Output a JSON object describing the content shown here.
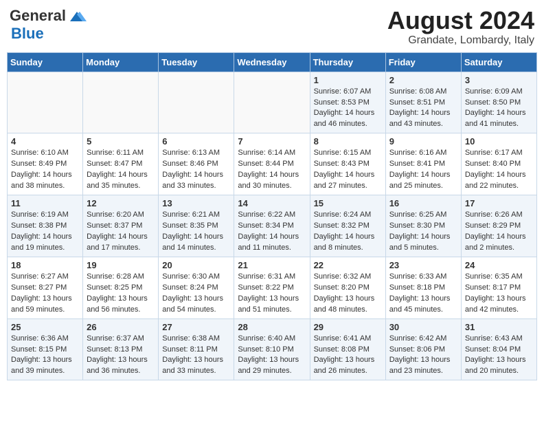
{
  "header": {
    "logo_general": "General",
    "logo_blue": "Blue",
    "month": "August 2024",
    "location": "Grandate, Lombardy, Italy"
  },
  "days_of_week": [
    "Sunday",
    "Monday",
    "Tuesday",
    "Wednesday",
    "Thursday",
    "Friday",
    "Saturday"
  ],
  "weeks": [
    [
      {
        "day": "",
        "info": ""
      },
      {
        "day": "",
        "info": ""
      },
      {
        "day": "",
        "info": ""
      },
      {
        "day": "",
        "info": ""
      },
      {
        "day": "1",
        "info": "Sunrise: 6:07 AM\nSunset: 8:53 PM\nDaylight: 14 hours and 46 minutes."
      },
      {
        "day": "2",
        "info": "Sunrise: 6:08 AM\nSunset: 8:51 PM\nDaylight: 14 hours and 43 minutes."
      },
      {
        "day": "3",
        "info": "Sunrise: 6:09 AM\nSunset: 8:50 PM\nDaylight: 14 hours and 41 minutes."
      }
    ],
    [
      {
        "day": "4",
        "info": "Sunrise: 6:10 AM\nSunset: 8:49 PM\nDaylight: 14 hours and 38 minutes."
      },
      {
        "day": "5",
        "info": "Sunrise: 6:11 AM\nSunset: 8:47 PM\nDaylight: 14 hours and 35 minutes."
      },
      {
        "day": "6",
        "info": "Sunrise: 6:13 AM\nSunset: 8:46 PM\nDaylight: 14 hours and 33 minutes."
      },
      {
        "day": "7",
        "info": "Sunrise: 6:14 AM\nSunset: 8:44 PM\nDaylight: 14 hours and 30 minutes."
      },
      {
        "day": "8",
        "info": "Sunrise: 6:15 AM\nSunset: 8:43 PM\nDaylight: 14 hours and 27 minutes."
      },
      {
        "day": "9",
        "info": "Sunrise: 6:16 AM\nSunset: 8:41 PM\nDaylight: 14 hours and 25 minutes."
      },
      {
        "day": "10",
        "info": "Sunrise: 6:17 AM\nSunset: 8:40 PM\nDaylight: 14 hours and 22 minutes."
      }
    ],
    [
      {
        "day": "11",
        "info": "Sunrise: 6:19 AM\nSunset: 8:38 PM\nDaylight: 14 hours and 19 minutes."
      },
      {
        "day": "12",
        "info": "Sunrise: 6:20 AM\nSunset: 8:37 PM\nDaylight: 14 hours and 17 minutes."
      },
      {
        "day": "13",
        "info": "Sunrise: 6:21 AM\nSunset: 8:35 PM\nDaylight: 14 hours and 14 minutes."
      },
      {
        "day": "14",
        "info": "Sunrise: 6:22 AM\nSunset: 8:34 PM\nDaylight: 14 hours and 11 minutes."
      },
      {
        "day": "15",
        "info": "Sunrise: 6:24 AM\nSunset: 8:32 PM\nDaylight: 14 hours and 8 minutes."
      },
      {
        "day": "16",
        "info": "Sunrise: 6:25 AM\nSunset: 8:30 PM\nDaylight: 14 hours and 5 minutes."
      },
      {
        "day": "17",
        "info": "Sunrise: 6:26 AM\nSunset: 8:29 PM\nDaylight: 14 hours and 2 minutes."
      }
    ],
    [
      {
        "day": "18",
        "info": "Sunrise: 6:27 AM\nSunset: 8:27 PM\nDaylight: 13 hours and 59 minutes."
      },
      {
        "day": "19",
        "info": "Sunrise: 6:28 AM\nSunset: 8:25 PM\nDaylight: 13 hours and 56 minutes."
      },
      {
        "day": "20",
        "info": "Sunrise: 6:30 AM\nSunset: 8:24 PM\nDaylight: 13 hours and 54 minutes."
      },
      {
        "day": "21",
        "info": "Sunrise: 6:31 AM\nSunset: 8:22 PM\nDaylight: 13 hours and 51 minutes."
      },
      {
        "day": "22",
        "info": "Sunrise: 6:32 AM\nSunset: 8:20 PM\nDaylight: 13 hours and 48 minutes."
      },
      {
        "day": "23",
        "info": "Sunrise: 6:33 AM\nSunset: 8:18 PM\nDaylight: 13 hours and 45 minutes."
      },
      {
        "day": "24",
        "info": "Sunrise: 6:35 AM\nSunset: 8:17 PM\nDaylight: 13 hours and 42 minutes."
      }
    ],
    [
      {
        "day": "25",
        "info": "Sunrise: 6:36 AM\nSunset: 8:15 PM\nDaylight: 13 hours and 39 minutes."
      },
      {
        "day": "26",
        "info": "Sunrise: 6:37 AM\nSunset: 8:13 PM\nDaylight: 13 hours and 36 minutes."
      },
      {
        "day": "27",
        "info": "Sunrise: 6:38 AM\nSunset: 8:11 PM\nDaylight: 13 hours and 33 minutes."
      },
      {
        "day": "28",
        "info": "Sunrise: 6:40 AM\nSunset: 8:10 PM\nDaylight: 13 hours and 29 minutes."
      },
      {
        "day": "29",
        "info": "Sunrise: 6:41 AM\nSunset: 8:08 PM\nDaylight: 13 hours and 26 minutes."
      },
      {
        "day": "30",
        "info": "Sunrise: 6:42 AM\nSunset: 8:06 PM\nDaylight: 13 hours and 23 minutes."
      },
      {
        "day": "31",
        "info": "Sunrise: 6:43 AM\nSunset: 8:04 PM\nDaylight: 13 hours and 20 minutes."
      }
    ]
  ]
}
